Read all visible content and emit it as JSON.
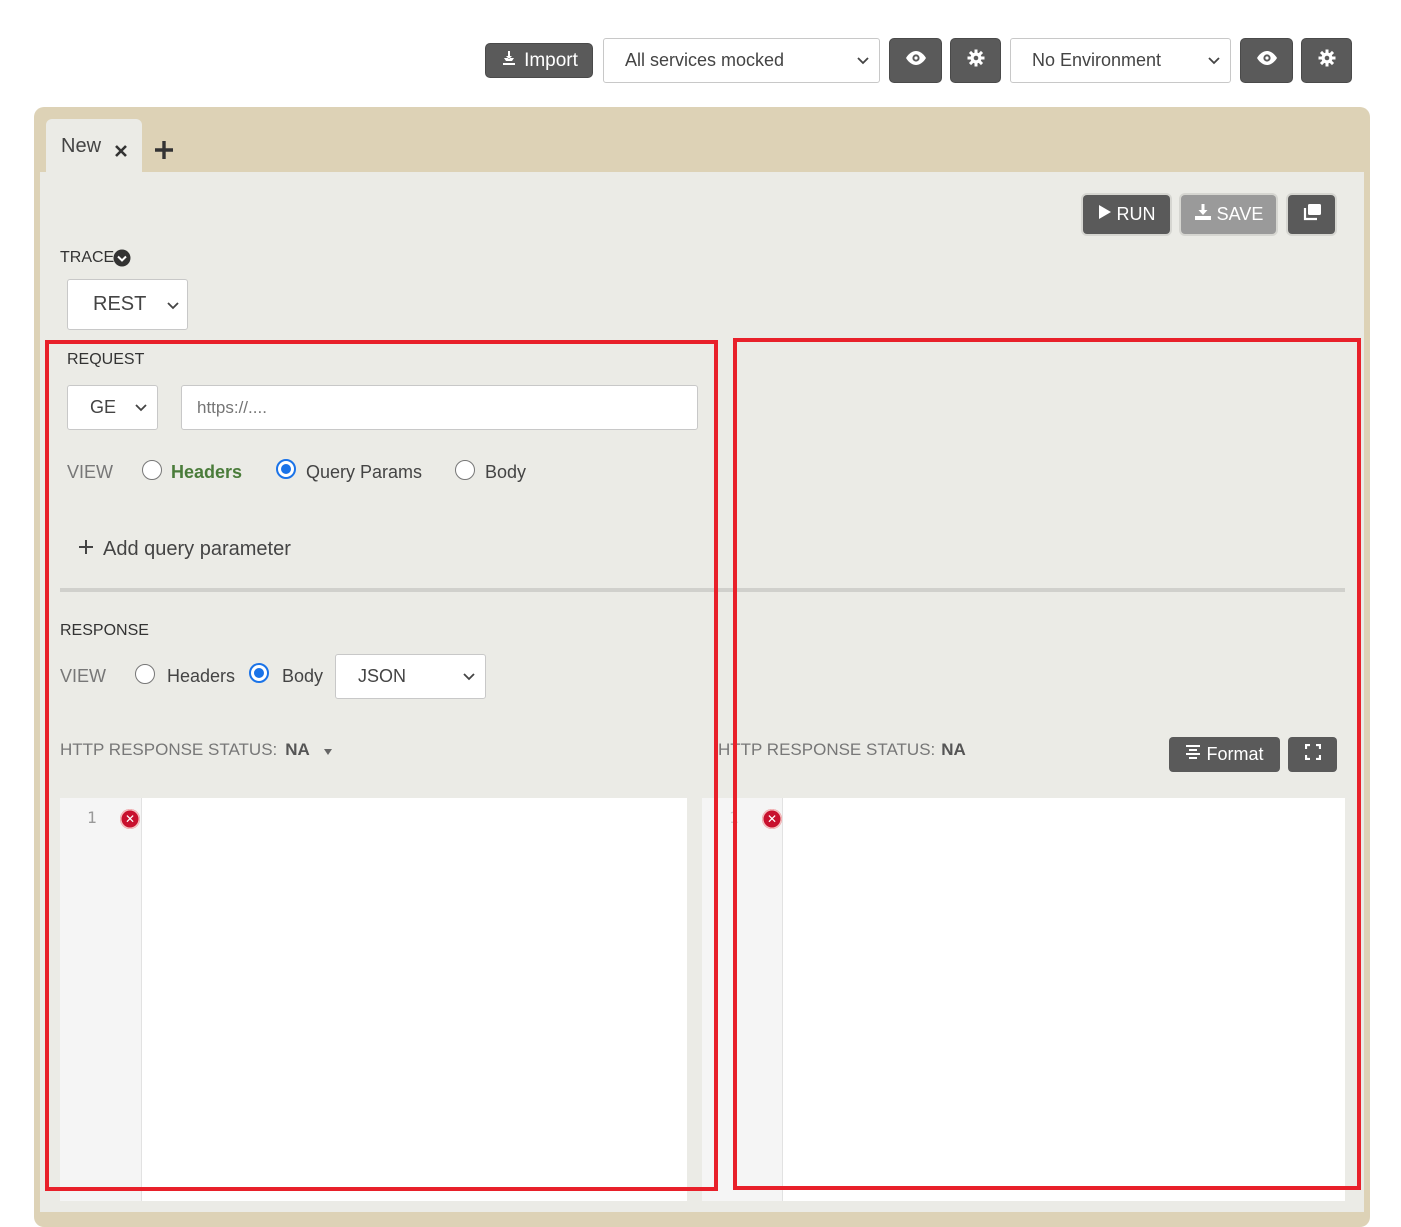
{
  "toolbar": {
    "import_label": "Import",
    "services_select": "All services mocked",
    "environment_select": "No Environment"
  },
  "tabs": [
    {
      "label": "New"
    }
  ],
  "actions": {
    "run_label": "RUN",
    "save_label": "SAVE"
  },
  "trace": {
    "label": "TRACE",
    "protocol": "REST"
  },
  "request": {
    "section_label": "REQUEST",
    "method": "GE",
    "url_placeholder": "https://....",
    "view_label": "VIEW",
    "views": [
      "Headers",
      "Query Params",
      "Body"
    ],
    "selected_view": "Query Params",
    "add_param_label": "Add query parameter"
  },
  "response": {
    "section_label": "RESPONSE",
    "view_label": "VIEW",
    "views": [
      "Headers",
      "Body"
    ],
    "selected_view": "Body",
    "format_select": "JSON",
    "status_label": "HTTP RESPONSE STATUS:",
    "status_value": "NA",
    "status_label_right": "HTTP RESPONSE STATUS:",
    "status_value_right": "NA",
    "format_button": "Format"
  },
  "editor": {
    "line_numbers": [
      "1",
      "1"
    ]
  },
  "colors": {
    "accent_blue": "#1a73e8",
    "headers_green": "#4a7c3a",
    "panel_tan": "#ddd2b6",
    "panel_bg": "#ebebe6",
    "annotation_red": "#e8202a",
    "button_dark": "#5a5a5a"
  }
}
